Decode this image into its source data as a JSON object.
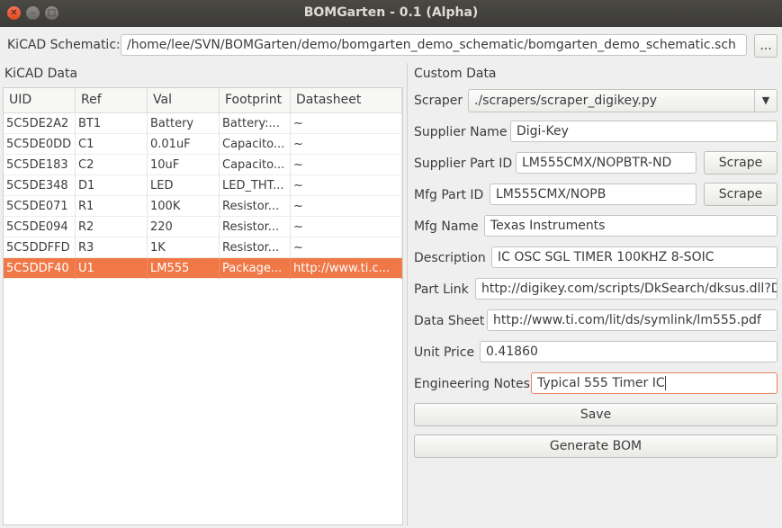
{
  "window": {
    "title": "BOMGarten - 0.1 (Alpha)"
  },
  "schematic": {
    "label": "KiCAD Schematic:",
    "path": "/home/lee/SVN/BOMGarten/demo/bomgarten_demo_schematic/bomgarten_demo_schematic.sch",
    "browse_label": "..."
  },
  "kicad": {
    "title": "KiCAD Data",
    "columns": [
      "UID",
      "Ref",
      "Val",
      "Footprint",
      "Datasheet"
    ],
    "rows": [
      [
        "5C5DE2A2",
        "BT1",
        "Battery",
        "Battery:...",
        "~"
      ],
      [
        "5C5DE0DD",
        "C1",
        "0.01uF",
        "Capacito...",
        "~"
      ],
      [
        "5C5DE183",
        "C2",
        "10uF",
        "Capacito...",
        "~"
      ],
      [
        "5C5DE348",
        "D1",
        "LED",
        "LED_THT...",
        "~"
      ],
      [
        "5C5DE071",
        "R1",
        "100K",
        "Resistor...",
        "~"
      ],
      [
        "5C5DE094",
        "R2",
        "220",
        "Resistor...",
        "~"
      ],
      [
        "5C5DDFFD",
        "R3",
        "1K",
        "Resistor...",
        "~"
      ],
      [
        "5C5DDF40",
        "U1",
        "LM555",
        "Package...",
        "http://www.ti.c..."
      ]
    ],
    "selected_row": 7
  },
  "custom": {
    "title": "Custom Data",
    "scraper": {
      "label": "Scraper",
      "value": "./scrapers/scraper_digikey.py"
    },
    "supplier_name": {
      "label": "Supplier Name",
      "value": "Digi-Key"
    },
    "supplier_part_id": {
      "label": "Supplier Part ID",
      "value": "LM555CMX/NOPBTR-ND",
      "button": "Scrape"
    },
    "mfg_part_id": {
      "label": "Mfg Part ID",
      "value": "LM555CMX/NOPB",
      "button": "Scrape"
    },
    "mfg_name": {
      "label": "Mfg Name",
      "value": "Texas Instruments"
    },
    "description": {
      "label": "Description",
      "value": "IC OSC SGL TIMER 100KHZ 8-SOIC"
    },
    "part_link": {
      "label": "Part Link",
      "value": "http://digikey.com/scripts/DkSearch/dksus.dll?D"
    },
    "data_sheet": {
      "label": "Data Sheet",
      "value": "http://www.ti.com/lit/ds/symlink/lm555.pdf"
    },
    "unit_price": {
      "label": "Unit Price",
      "value": "0.41860"
    },
    "engineering_notes": {
      "label": "Engineering Notes",
      "value": "Typical 555 Timer IC"
    },
    "save_label": "Save",
    "generate_label": "Generate BOM"
  },
  "colors": {
    "accent": "#f07746",
    "titlebar": "#3c3b37",
    "background": "#efefef"
  }
}
